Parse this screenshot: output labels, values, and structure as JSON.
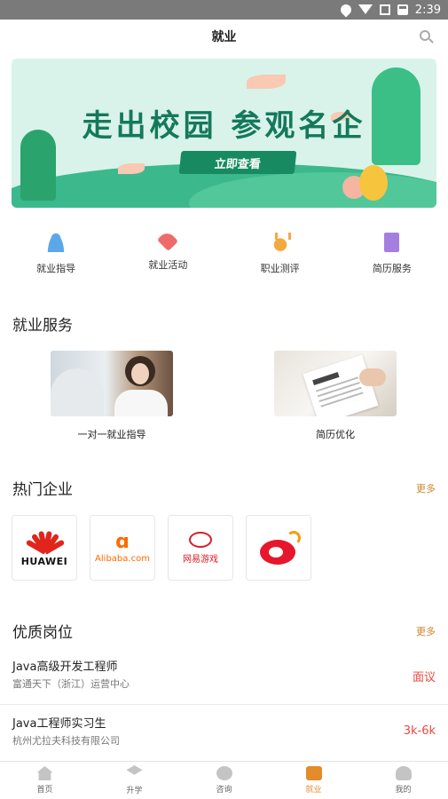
{
  "status_bar": {
    "time": "2:39"
  },
  "header": {
    "title": "就业"
  },
  "banner": {
    "headline": "走出校园 参观名企",
    "cta": "立即查看"
  },
  "quick_entries": [
    {
      "label": "就业指导",
      "icon": "user-icon",
      "color": "#5ba8e8"
    },
    {
      "label": "就业活动",
      "icon": "tag-icon",
      "color": "#ef6b6b"
    },
    {
      "label": "职业测评",
      "icon": "medal-icon",
      "color": "#f4a93c"
    },
    {
      "label": "简历服务",
      "icon": "book-icon",
      "color": "#a57fe0"
    }
  ],
  "services": {
    "title": "就业服务",
    "items": [
      {
        "caption": "一对一就业指导"
      },
      {
        "caption": "简历优化"
      }
    ]
  },
  "companies": {
    "title": "热门企业",
    "more": "更多",
    "items": [
      {
        "name": "HUAWEI"
      },
      {
        "name": "Alibaba.com"
      },
      {
        "name": "网易游戏"
      },
      {
        "name": "weibo"
      }
    ]
  },
  "jobs": {
    "title": "优质岗位",
    "more": "更多",
    "items": [
      {
        "title": "Java高级开发工程师",
        "company": "富通天下（浙江）运营中心",
        "salary": "面议"
      },
      {
        "title": "Java工程师实习生",
        "company": "杭州尤拉夫科技有限公司",
        "salary": "3k-6k"
      }
    ]
  },
  "tabbar": {
    "active_color": "#e48b2a",
    "items": [
      {
        "label": "首页",
        "icon": "home-icon"
      },
      {
        "label": "升学",
        "icon": "graduation-cap-icon"
      },
      {
        "label": "咨询",
        "icon": "chat-icon"
      },
      {
        "label": "就业",
        "icon": "briefcase-icon",
        "active": true
      },
      {
        "label": "我的",
        "icon": "profile-icon"
      }
    ]
  }
}
